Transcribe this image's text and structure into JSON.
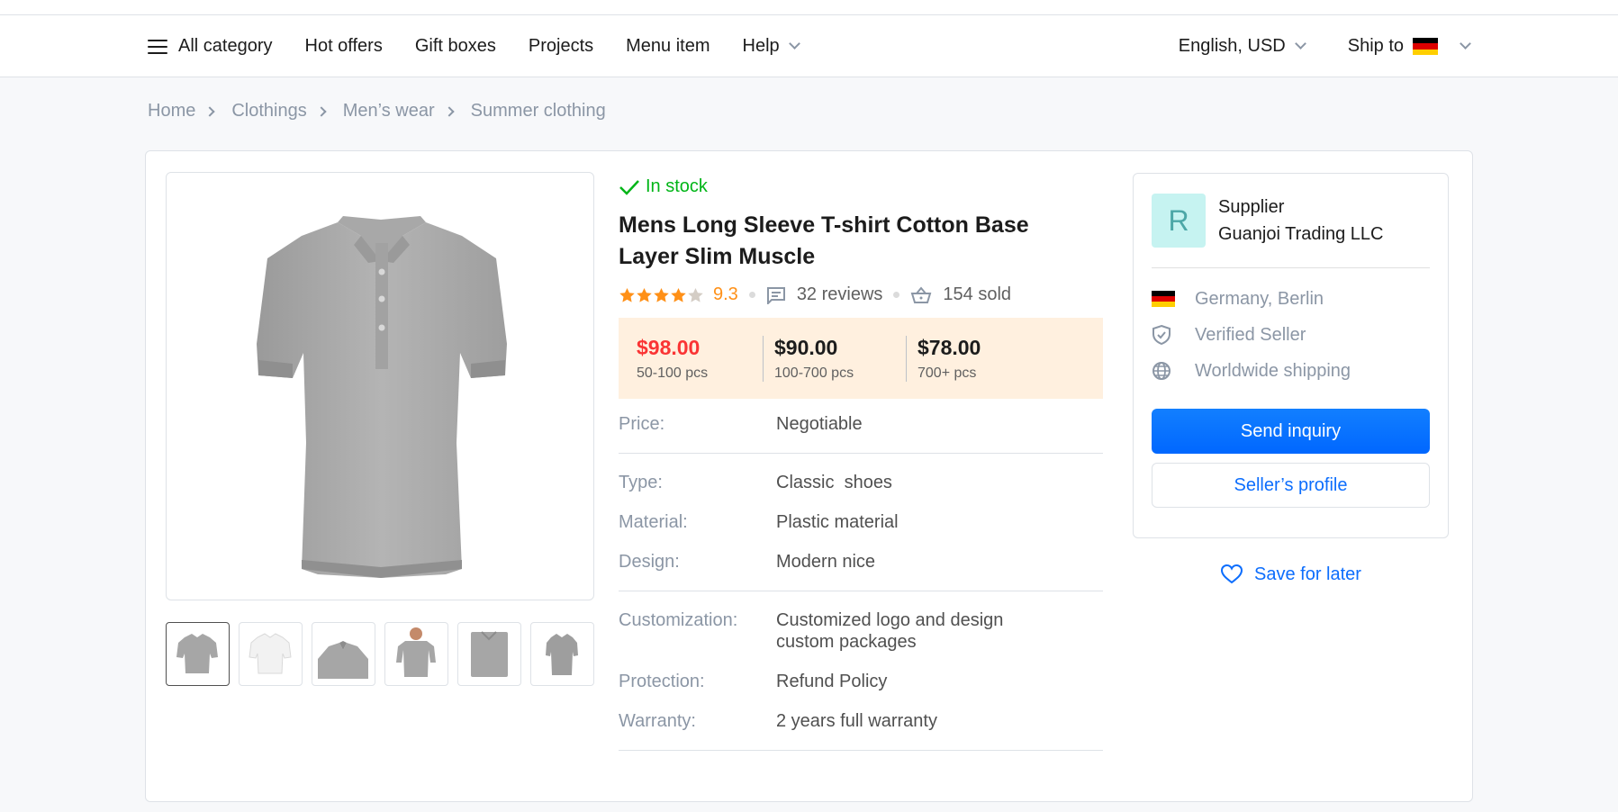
{
  "nav": {
    "all_category": "All category",
    "links": [
      "Hot offers",
      "Gift boxes",
      "Projects",
      "Menu item",
      "Help"
    ],
    "language": "English, USD",
    "ship_to": "Ship to"
  },
  "breadcrumb": [
    "Home",
    "Clothings",
    "Men’s wear",
    "Summer clothing"
  ],
  "product": {
    "stock": "In stock",
    "title": "Mens Long Sleeve T-shirt Cotton Base Layer Slim Muscle",
    "rating": "9.3",
    "rating_stars": 4,
    "reviews": "32 reviews",
    "sold": "154 sold",
    "price_tiers": [
      {
        "price": "$98.00",
        "qty": "50-100 pcs"
      },
      {
        "price": "$90.00",
        "qty": "100-700 pcs"
      },
      {
        "price": "$78.00",
        "qty": "700+ pcs"
      }
    ],
    "specs": {
      "price": {
        "label": "Price:",
        "value": "Negotiable"
      },
      "type": {
        "label": "Type:",
        "value": "Classic  shoes"
      },
      "material": {
        "label": "Material:",
        "value": "Plastic material"
      },
      "design": {
        "label": "Design:",
        "value": "Modern nice"
      },
      "customization": {
        "label": "Customization:",
        "value": "Customized logo and design custom packages"
      },
      "protection": {
        "label": "Protection:",
        "value": "Refund Policy"
      },
      "warranty": {
        "label": "Warranty:",
        "value": "2 years full warranty"
      }
    }
  },
  "supplier": {
    "avatar_letter": "R",
    "label": "Supplier",
    "name": "Guanjoi Trading LLC",
    "location": "Germany, Berlin",
    "verified": "Verified Seller",
    "shipping": "Worldwide shipping",
    "send_inquiry": "Send inquiry",
    "profile": "Seller’s profile"
  },
  "save_for_later": "Save for later",
  "colors": {
    "accent": "#0d6efd",
    "in_stock": "#00b517",
    "rating": "#ff9017",
    "price_highlight": "#fa3434",
    "price_box_bg": "#fff0df"
  },
  "icons": [
    "menu-icon",
    "chevron-down-icon",
    "germany-flag-icon",
    "chevron-right-icon",
    "check-icon",
    "star-icon",
    "message-icon",
    "basket-icon",
    "shield-check-icon",
    "globe-icon",
    "heart-icon"
  ]
}
